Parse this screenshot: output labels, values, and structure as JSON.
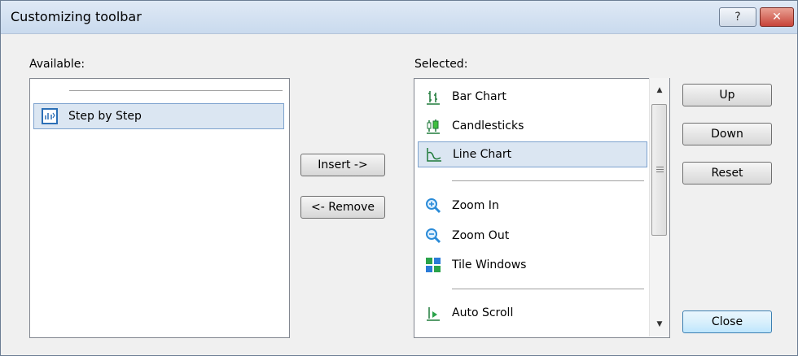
{
  "window": {
    "title": "Customizing toolbar",
    "help_glyph": "?",
    "close_glyph": "✕"
  },
  "available": {
    "label": "Available:",
    "items": [
      {
        "label": "Step by Step",
        "icon": "step-by-step-icon",
        "selected": true
      }
    ]
  },
  "selected": {
    "label": "Selected:",
    "items": [
      {
        "type": "item",
        "label": "Bar Chart",
        "icon": "bar-chart-icon"
      },
      {
        "type": "item",
        "label": "Candlesticks",
        "icon": "candlesticks-icon"
      },
      {
        "type": "item",
        "label": "Line Chart",
        "icon": "line-chart-icon",
        "selected": true
      },
      {
        "type": "separator"
      },
      {
        "type": "item",
        "label": "Zoom In",
        "icon": "zoom-in-icon"
      },
      {
        "type": "item",
        "label": "Zoom Out",
        "icon": "zoom-out-icon"
      },
      {
        "type": "item",
        "label": "Tile Windows",
        "icon": "tile-windows-icon"
      },
      {
        "type": "separator"
      },
      {
        "type": "item",
        "label": "Auto Scroll",
        "icon": "auto-scroll-icon"
      }
    ]
  },
  "buttons": {
    "insert": "Insert ->",
    "remove": "<- Remove",
    "up": "Up",
    "down": "Down",
    "reset": "Reset",
    "close": "Close"
  },
  "colors": {
    "selection": "#dbe6f2",
    "selection_border": "#7da2ce",
    "default_button": "#bee6fd"
  }
}
